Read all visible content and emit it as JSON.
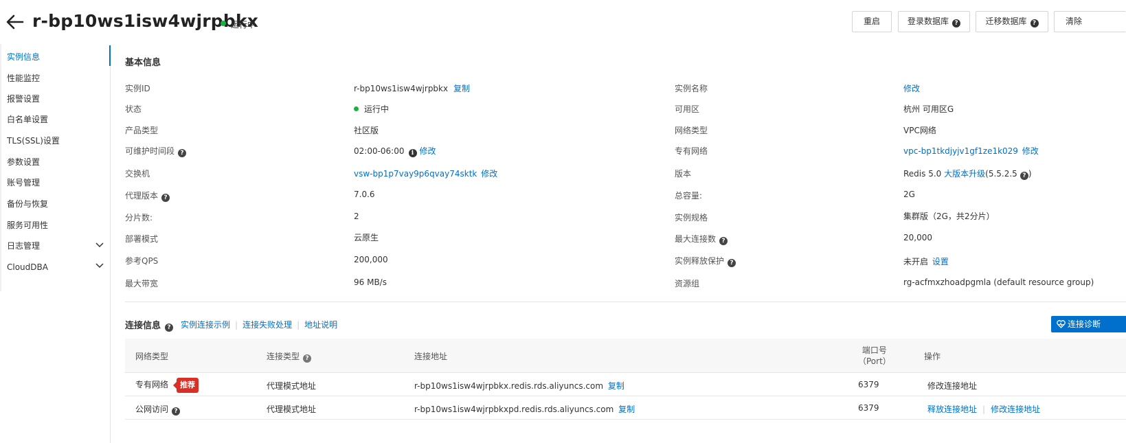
{
  "header": {
    "title": "r-bp10ws1isw4wjrpbkx",
    "status": "运行中",
    "buttons": {
      "restart": "重启",
      "login_db": "登录数据库",
      "migrate_db": "迁移数据库",
      "clear": "清除"
    }
  },
  "sidebar": {
    "items": [
      {
        "label": "实例信息"
      },
      {
        "label": "性能监控"
      },
      {
        "label": "报警设置"
      },
      {
        "label": "白名单设置"
      },
      {
        "label": "TLS(SSL)设置"
      },
      {
        "label": "参数设置"
      },
      {
        "label": "账号管理"
      },
      {
        "label": "备份与恢复"
      },
      {
        "label": "服务可用性"
      },
      {
        "label": "日志管理"
      },
      {
        "label": "CloudDBA"
      }
    ]
  },
  "basic": {
    "title": "基本信息",
    "instance_id_label": "实例ID",
    "instance_id": "r-bp10ws1isw4wjrpbkx",
    "copy": "复制",
    "instance_name_label": "实例名称",
    "modify": "修改",
    "status_label": "状态",
    "status": "运行中",
    "zone_label": "可用区",
    "zone": "杭州 可用区G",
    "product_type_label": "产品类型",
    "product_type": "社区版",
    "network_type_label": "网络类型",
    "network_type": "VPC网络",
    "maintenance_label": "可维护时间段",
    "maintenance": "02:00-06:00",
    "vpc_label": "专有网络",
    "vpc": "vpc-bp1tkdjyjv1gf1ze1k029",
    "vswitch_label": "交换机",
    "vswitch": "vsw-bp1p7vay9p6qvay74sktk",
    "version_label": "版本",
    "version_prefix": "Redis 5.0",
    "version_upgrade": "大版本升级",
    "version_suffix": "(5.5.2.5",
    "version_close": ")",
    "proxy_version_label": "代理版本",
    "proxy_version": "7.0.6",
    "capacity_label": "总容量:",
    "capacity": "2G",
    "shards_label": "分片数:",
    "shards": "2",
    "spec_label": "实例规格",
    "spec": "集群版（2G，共2分片）",
    "deploy_label": "部署模式",
    "deploy": "云原生",
    "max_conn_label": "最大连接数",
    "max_conn": "20,000",
    "qps_label": "参考QPS",
    "qps": "200,000",
    "release_label": "实例释放保护",
    "release": "未开启",
    "release_set": "设置",
    "bandwidth_label": "最大带宽",
    "bandwidth": "96 MB/s",
    "rg_label": "资源组",
    "rg": "rg-acfmxzhoadpgmla (default resource group)"
  },
  "connection": {
    "title": "连接信息",
    "links": [
      "实例连接示例",
      "连接失败处理",
      "地址说明"
    ],
    "diag_button": "连接诊断",
    "columns": {
      "network_type": "网络类型",
      "conn_type": "连接类型",
      "address": "连接地址",
      "port_line1": "端口号",
      "port_line2": "（Port）",
      "actions": "操作"
    },
    "rows": [
      {
        "network": "专有网络",
        "badge": "推荐",
        "type": "代理模式地址",
        "address": "r-bp10ws1isw4wjrpbkx.redis.rds.aliyuncs.com",
        "copy": "复制",
        "port": "6379",
        "action1": "修改连接地址"
      },
      {
        "network": "公网访问",
        "type": "代理模式地址",
        "address": "r-bp10ws1isw4wjrpbkxpd.redis.rds.aliyuncs.com",
        "copy": "复制",
        "port": "6379",
        "action1": "释放连接地址",
        "action2": "修改连接地址"
      }
    ]
  },
  "colors": {
    "accent": "#0070cc",
    "status_green": "#16b33d",
    "badge_red": "#d93026"
  },
  "icons": [
    "back-arrow-icon",
    "help-icon",
    "info-icon",
    "chevron-down-icon",
    "heart-monitor-icon"
  ]
}
